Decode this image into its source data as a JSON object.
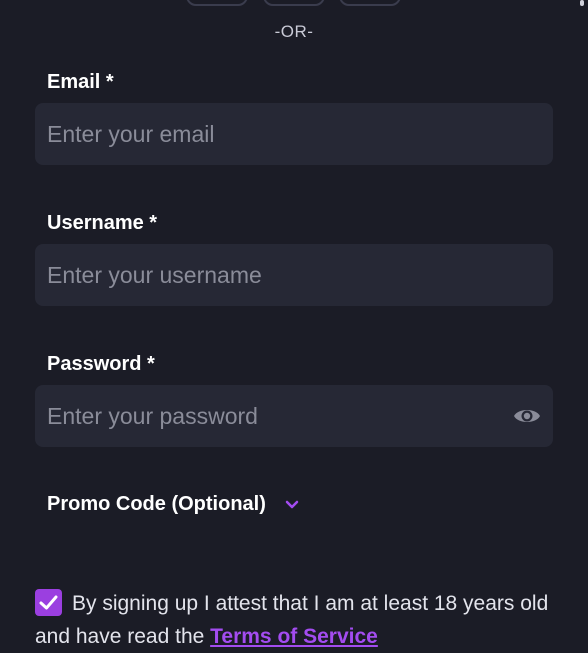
{
  "divider": {
    "text": "-OR-"
  },
  "fields": {
    "email": {
      "label": "Email *",
      "placeholder": "Enter your email",
      "value": ""
    },
    "username": {
      "label": "Username *",
      "placeholder": "Enter your username",
      "value": ""
    },
    "password": {
      "label": "Password *",
      "placeholder": "Enter your password",
      "value": ""
    }
  },
  "promo": {
    "label": "Promo Code (Optional)",
    "icon": "chevron-down-icon"
  },
  "terms": {
    "checked": true,
    "text_before": "By signing up I attest that I am at least 18 years old and have read the ",
    "link_label": "Terms of Service"
  },
  "colors": {
    "background": "#1b1c26",
    "input_background": "#262835",
    "accent": "#9b3fe0",
    "placeholder": "#8a8c99"
  }
}
